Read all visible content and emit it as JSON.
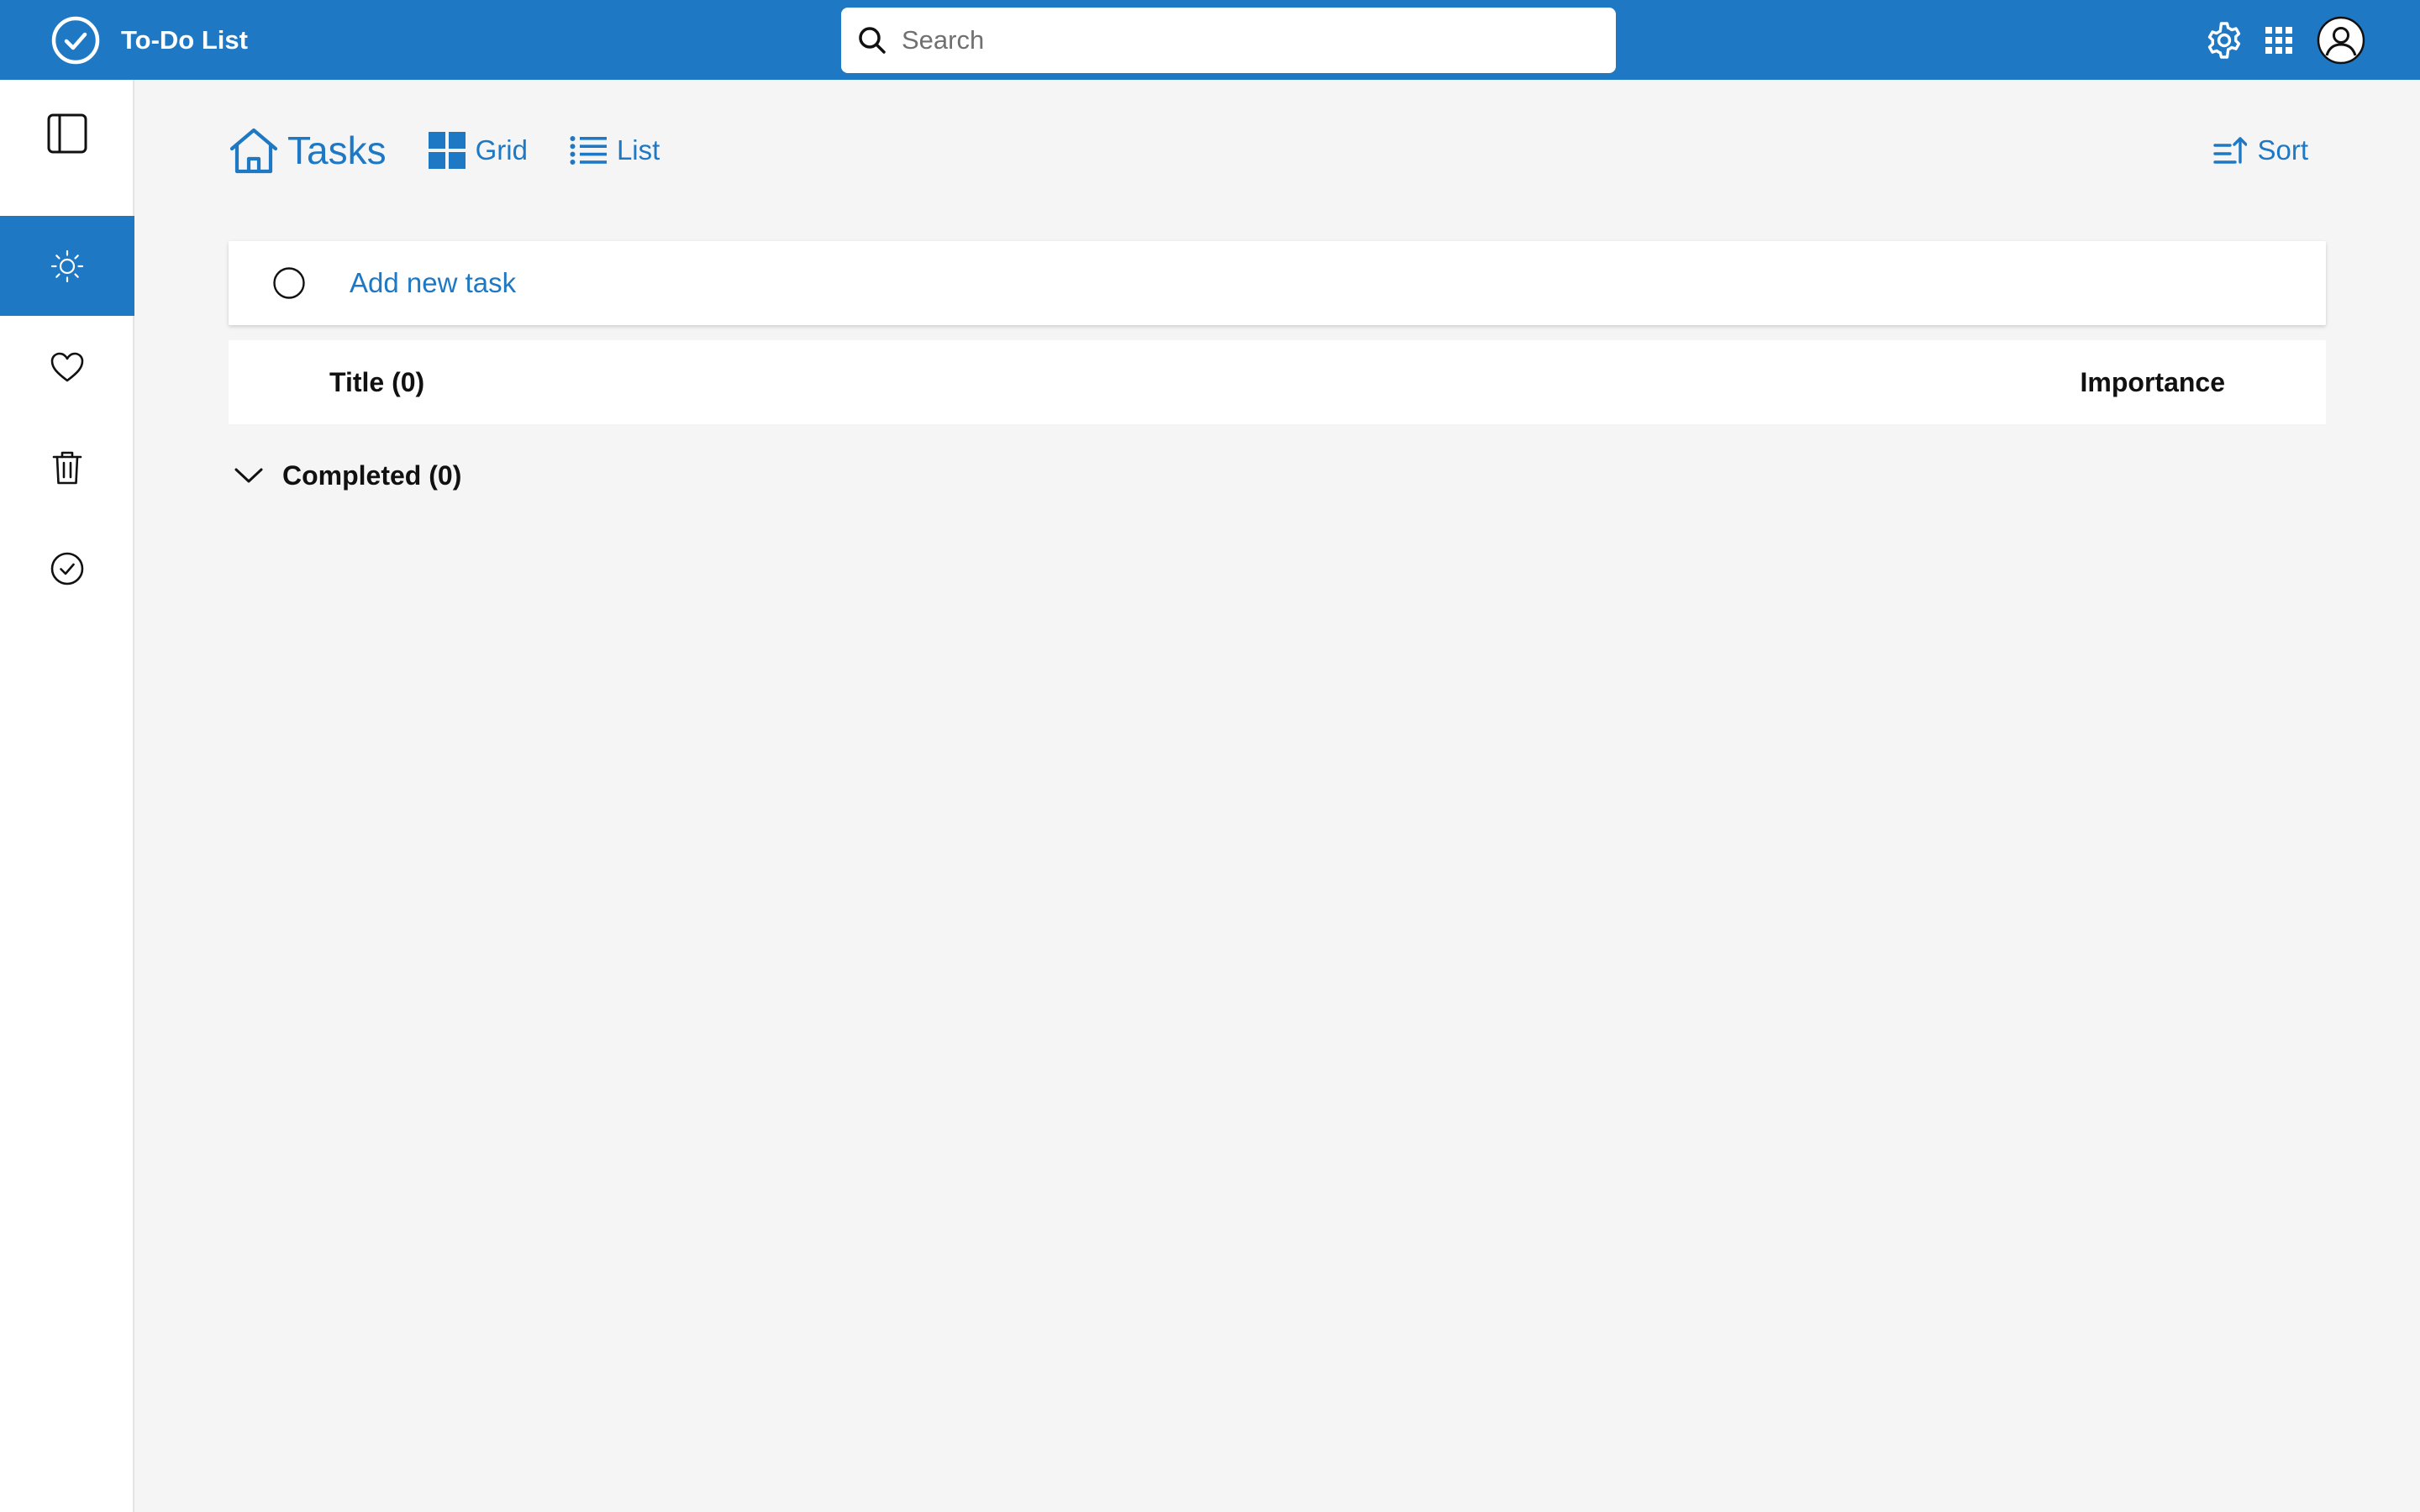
{
  "app": {
    "title": "To-Do List"
  },
  "search": {
    "placeholder": "Search",
    "value": ""
  },
  "header_actions": {
    "settings_icon": "gear-icon",
    "apps_icon": "grid-dots-icon",
    "account_icon": "user-avatar-icon"
  },
  "sidebar": {
    "toggle_icon": "sidebar-panel-icon",
    "items": [
      {
        "id": "my-day",
        "icon": "sun-icon",
        "active": true
      },
      {
        "id": "favorites",
        "icon": "heart-icon",
        "active": false
      },
      {
        "id": "deleted",
        "icon": "trash-icon",
        "active": false
      },
      {
        "id": "completed",
        "icon": "check-circle-icon",
        "active": false
      }
    ]
  },
  "toolbar": {
    "home_label": "Tasks",
    "grid_label": "Grid",
    "list_label": "List",
    "sort_label": "Sort"
  },
  "add_task": {
    "placeholder": "Add new task",
    "value": ""
  },
  "table": {
    "title_header": "Title (0)",
    "importance_header": "Importance",
    "rows": []
  },
  "completed": {
    "label": "Completed (0)",
    "expanded": true,
    "items": []
  },
  "colors": {
    "accent": "#1e78c4",
    "background": "#f5f5f5",
    "surface": "#ffffff"
  }
}
